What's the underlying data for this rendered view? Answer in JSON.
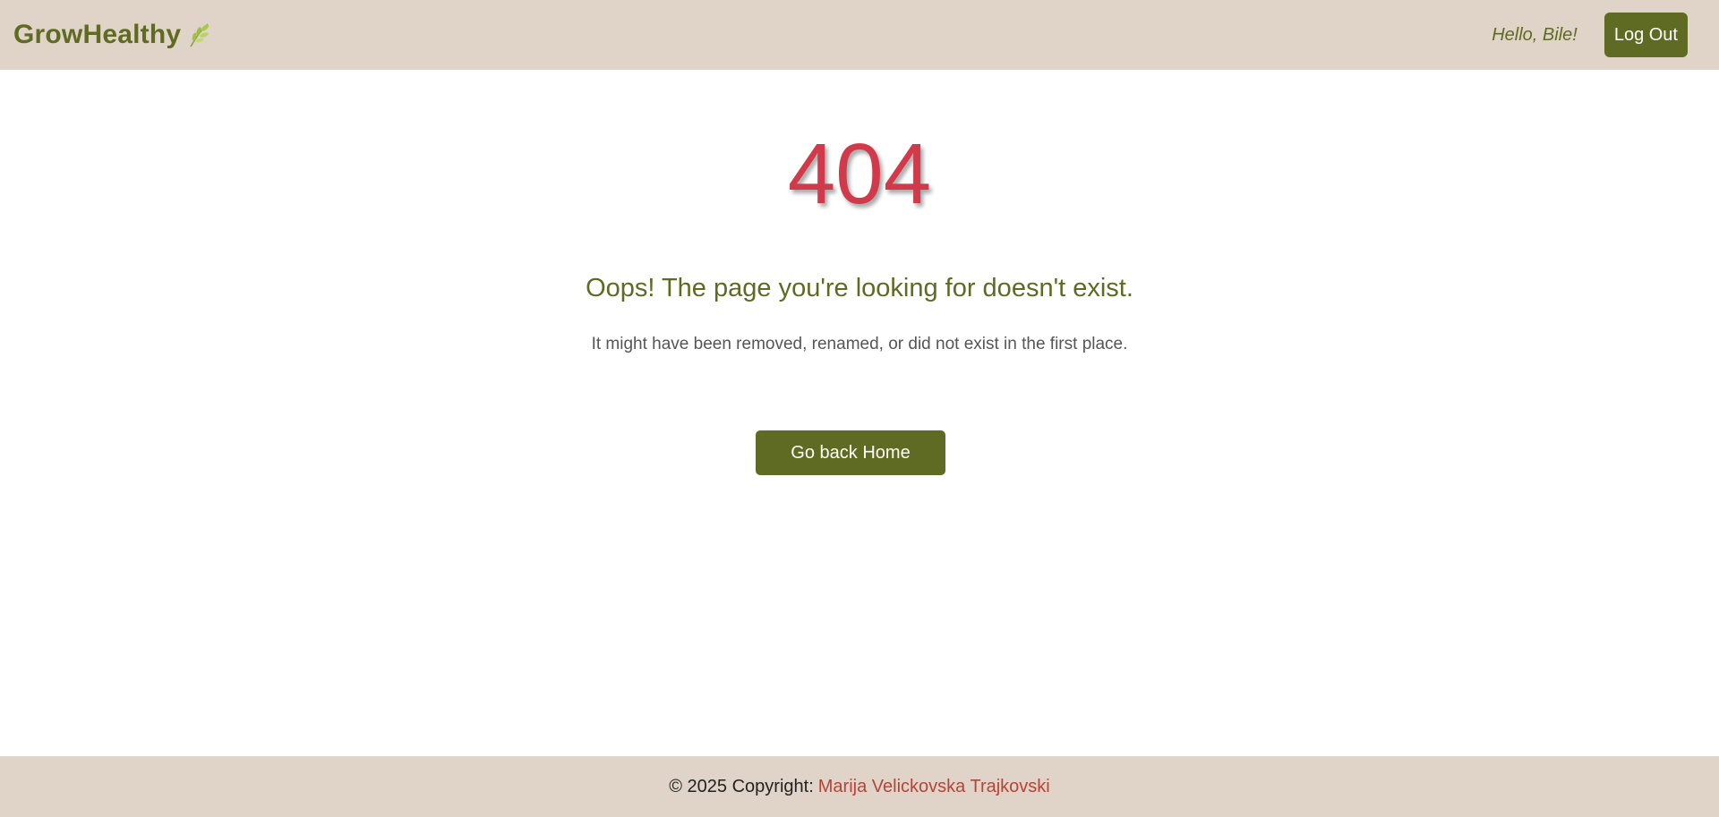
{
  "navbar": {
    "brand": "GrowHealthy",
    "brand_icon": "leaf-icon",
    "greeting": "Hello, Bile!",
    "logout_label": "Log Out"
  },
  "error": {
    "code": "404",
    "headline": "Oops! The page you're looking for doesn't exist.",
    "message": "It might have been removed, renamed, or did not exist in the first place.",
    "home_button_label": "Go back Home"
  },
  "footer": {
    "copyright": "© 2025 Copyright:",
    "author": "Marija Velickovska Trajkovski"
  },
  "colors": {
    "nav_bg": "#dfd4c7",
    "brand_green": "#5f6b22",
    "error_red": "#d13a4a",
    "author_link": "#b5443a"
  }
}
